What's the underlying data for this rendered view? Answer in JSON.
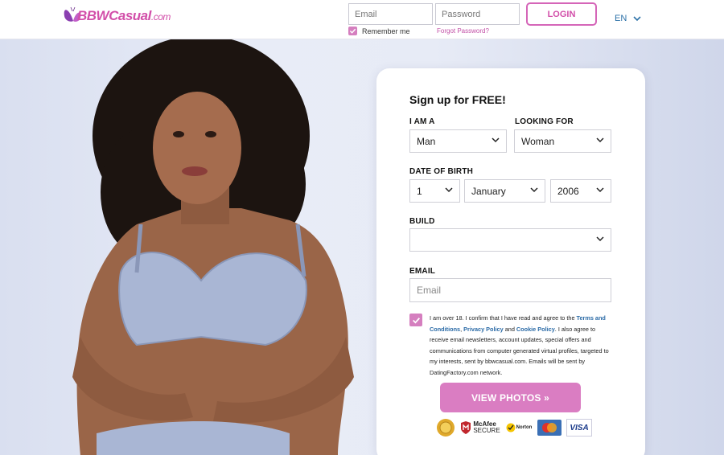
{
  "header": {
    "brand": "BBWCasual",
    "brand_domain": ".com",
    "email_placeholder": "Email",
    "password_placeholder": "Password",
    "login_label": "LOGIN",
    "remember_label": "Remember me",
    "forgot_label": "Forgot Password?",
    "language": "EN"
  },
  "signup": {
    "title": "Sign up for FREE!",
    "i_am_label": "I AM A",
    "i_am_value": "Man",
    "looking_for_label": "LOOKING FOR",
    "looking_for_value": "Woman",
    "dob_label": "DATE OF BIRTH",
    "dob_day": "1",
    "dob_month": "January",
    "dob_year": "2006",
    "build_label": "BUILD",
    "build_value": "",
    "email_label": "EMAIL",
    "email_placeholder": "Email",
    "terms": {
      "t1": "I am over 18. I confirm that I have read and agree to the ",
      "terms_link": "Terms and Conditions",
      "t2": ", ",
      "privacy_link": "Privacy Policy",
      "t3": " and ",
      "cookie_link": "Cookie Policy",
      "t4": ". I also agree to receive email newsletters, account updates, special offers and communications from computer generated virtual profiles, targeted to my interests, sent by bbwcasual.com. Emails will be sent by DatingFactory.com network."
    },
    "cta_label": "VIEW PHOTOS »",
    "badges": {
      "mcafee": "McAfee",
      "mcafee_sub": "SECURE",
      "norton": "Norton",
      "visa": "VISA"
    }
  },
  "colors": {
    "accent": "#d24fa9",
    "button": "#da7dc2",
    "link": "#2a6aa6"
  }
}
